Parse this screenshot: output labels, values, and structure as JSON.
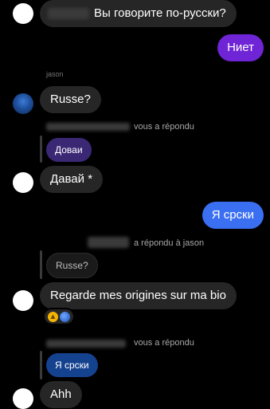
{
  "messages": {
    "m1": {
      "text": "Вы говорите по-русски?"
    },
    "m2": {
      "text": "Ниет"
    },
    "m3": {
      "sender_fragment": "jason",
      "text": "Russe?"
    },
    "m4": {
      "reply_meta": "vous a répondu",
      "quoted": "Доваи",
      "text": "Давай *"
    },
    "m5": {
      "text": "Я срски"
    },
    "m6": {
      "reply_meta": "a répondu à jason",
      "quoted": "Russe?",
      "text": "Regarde mes origines sur ma bio",
      "reactions": [
        "thumbs-up",
        "globe"
      ]
    },
    "m7": {
      "reply_meta": "vous a répondu",
      "quoted": "Я срски",
      "text": "Ahh"
    }
  },
  "colors": {
    "background": "#000000",
    "incoming_bubble": "#262626",
    "outgoing_purple": "#6f24d6",
    "outgoing_blue": "#3b6ff2"
  }
}
